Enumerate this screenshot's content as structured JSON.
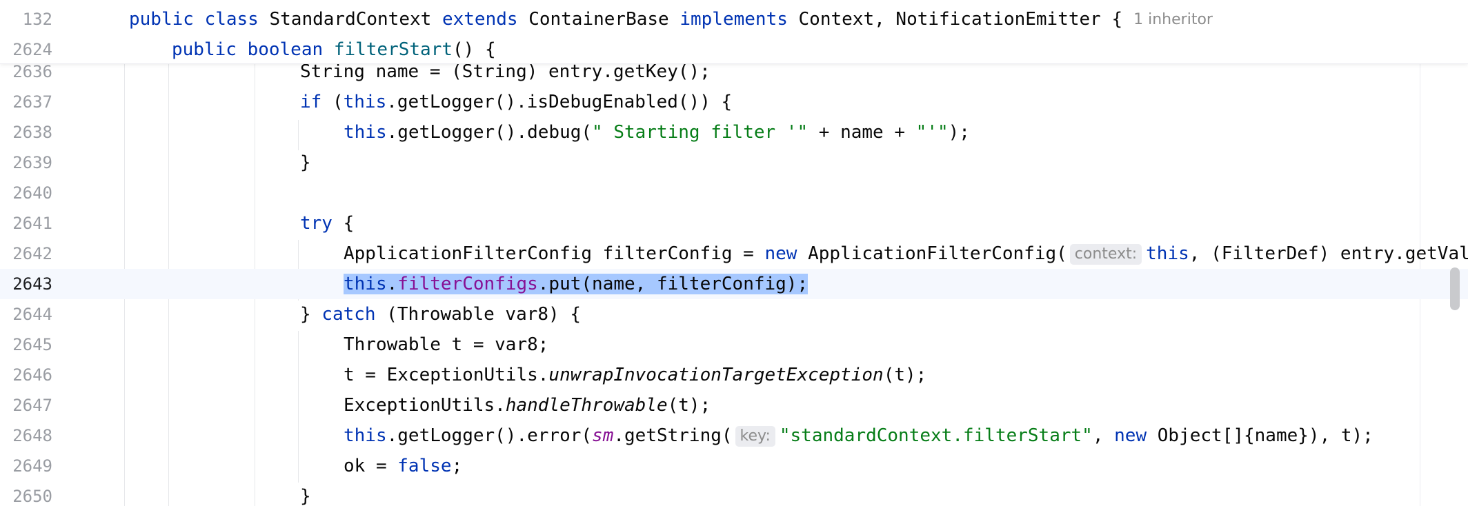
{
  "sticky": {
    "line1": {
      "number": "132",
      "tokens": {
        "t1": "public class ",
        "t2": "StandardContext ",
        "t3": "extends ",
        "t4": "ContainerBase ",
        "t5": "implements ",
        "t6": "Context, NotificationEmitter {",
        "hint": "1 inheritor"
      }
    },
    "line2": {
      "number": "2624",
      "tokens": {
        "t1": "public boolean ",
        "t2": "filterStart",
        "t3": "() {"
      }
    }
  },
  "lines": {
    "l2636": {
      "number": "2636",
      "tokens": {
        "t1": "String name = (String) entry.getKey();"
      }
    },
    "l2637": {
      "number": "2637",
      "tokens": {
        "t1": "if ",
        "t2": "(",
        "t3": "this",
        "t4": ".getLogger().isDebugEnabled()) {"
      }
    },
    "l2638": {
      "number": "2638",
      "tokens": {
        "t1": "this",
        "t2": ".getLogger().debug(",
        "t3": "\" Starting filter '\"",
        "t4": " + name + ",
        "t5": "\"'\"",
        "t6": ");"
      }
    },
    "l2639": {
      "number": "2639",
      "tokens": {
        "t1": "}"
      }
    },
    "l2640": {
      "number": "2640"
    },
    "l2641": {
      "number": "2641",
      "tokens": {
        "t1": "try ",
        "t2": "{"
      }
    },
    "l2642": {
      "number": "2642",
      "tokens": {
        "t1": "ApplicationFilterConfig filterConfig = ",
        "t2": "new ",
        "t3": "ApplicationFilterConfig(",
        "hint": "context:",
        "t4": "this",
        "t5": ", (FilterDef) entry.getValue());"
      }
    },
    "l2643": {
      "number": "2643",
      "tokens": {
        "t1": "this",
        "t2": ".",
        "t3": "filterConfigs",
        "t4": ".put(name, filterConfig);"
      }
    },
    "l2644": {
      "number": "2644",
      "tokens": {
        "t1": "} ",
        "t2": "catch ",
        "t3": "(Throwable var8) {"
      }
    },
    "l2645": {
      "number": "2645",
      "tokens": {
        "t1": "Throwable t = var8;"
      }
    },
    "l2646": {
      "number": "2646",
      "tokens": {
        "t1": "t = ExceptionUtils.",
        "t2": "unwrapInvocationTargetException",
        "t3": "(t);"
      }
    },
    "l2647": {
      "number": "2647",
      "tokens": {
        "t1": "ExceptionUtils.",
        "t2": "handleThrowable",
        "t3": "(t);"
      }
    },
    "l2648": {
      "number": "2648",
      "tokens": {
        "t1": "this",
        "t2": ".getLogger().error(",
        "t3": "sm",
        "t4": ".getString(",
        "hint": "key:",
        "t5": "\"standardContext.filterStart\"",
        "t6": ", ",
        "t7": "new ",
        "t8": "Object[]{name}), t);"
      }
    },
    "l2649": {
      "number": "2649",
      "tokens": {
        "t1": "ok = ",
        "t2": "false",
        "t3": ";"
      }
    },
    "l2650": {
      "number": "2650",
      "tokens": {
        "t1": "}"
      }
    }
  },
  "colors": {
    "keyword": "#0033b3",
    "function": "#00627a",
    "string": "#067d17",
    "field": "#871094",
    "selection": "#a6c8ff",
    "current_line": "#f5f8fe"
  }
}
